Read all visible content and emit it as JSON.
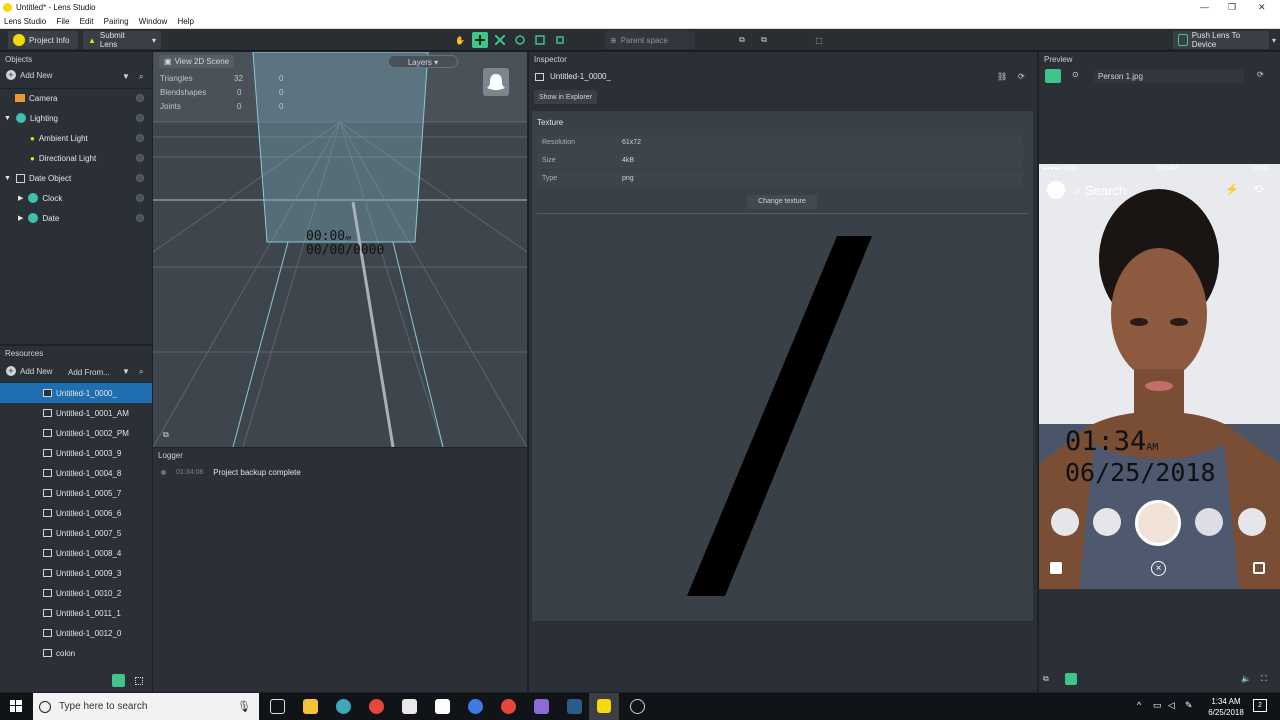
{
  "window": {
    "title": "Untitled* - Lens Studio",
    "minimize": "—",
    "restore": "❐",
    "close": "✕"
  },
  "menu": [
    "Lens Studio",
    "File",
    "Edit",
    "Pairing",
    "Window",
    "Help"
  ],
  "toolbar": {
    "project_info": "Project Info",
    "submit_lens": "Submit Lens",
    "parent_space": "Parent space",
    "push_lens": "Push Lens To Device"
  },
  "objects": {
    "title": "Objects",
    "add_new": "Add New",
    "items": [
      {
        "label": "Camera",
        "icon": "camera-icon"
      },
      {
        "label": "Lighting",
        "icon": "group-icon"
      },
      {
        "label": "Ambient Light",
        "icon": "light-icon"
      },
      {
        "label": "Directional Light",
        "icon": "light-icon"
      },
      {
        "label": "Date Object",
        "icon": "object-icon"
      },
      {
        "label": "Clock",
        "icon": "group-icon"
      },
      {
        "label": "Date",
        "icon": "group-icon"
      }
    ]
  },
  "resources": {
    "title": "Resources",
    "add_new": "Add New",
    "add_from": "Add From...",
    "items": [
      "Untitled-1_0000_",
      "Untitled-1_0001_AM",
      "Untitled-1_0002_PM",
      "Untitled-1_0003_9",
      "Untitled-1_0004_8",
      "Untitled-1_0005_7",
      "Untitled-1_0006_6",
      "Untitled-1_0007_5",
      "Untitled-1_0008_4",
      "Untitled-1_0009_3",
      "Untitled-1_0010_2",
      "Untitled-1_0011_1",
      "Untitled-1_0012_0",
      "colon"
    ]
  },
  "scene": {
    "view_btn": "View 2D Scene",
    "layers": "Layers",
    "stats": [
      {
        "label": "Triangles",
        "a": "32",
        "b": "0"
      },
      {
        "label": "Blendshapes",
        "a": "0",
        "b": "0"
      },
      {
        "label": "Joints",
        "a": "0",
        "b": "0"
      }
    ],
    "time_text": "00:00",
    "time_suffix": "AM",
    "date_text": "00/00/0000"
  },
  "logger": {
    "title": "Logger",
    "entries": [
      {
        "time": "01:34:08",
        "message": "Project backup complete"
      }
    ]
  },
  "inspector": {
    "title": "Inspector",
    "asset_name": "Untitled-1_0000_",
    "show_in_explorer": "Show in Explorer",
    "section": "Texture",
    "rows": [
      {
        "key": "Resolution",
        "value": "61x72"
      },
      {
        "key": "Size",
        "value": "4kB"
      },
      {
        "key": "Type",
        "value": "png"
      }
    ],
    "change_texture": "Change texture"
  },
  "preview": {
    "title": "Preview",
    "file": "Person 1.jpg",
    "status_carrier": "●●●●● Snap",
    "status_time": "9:41 AM",
    "status_batt": "100%",
    "search": "Search",
    "time": "01:34",
    "ampm": "AM",
    "date": "06/25/2018"
  },
  "taskbar": {
    "search_placeholder": "Type here to search",
    "time": "1:34 AM",
    "date": "6/25/2018",
    "notif": "2"
  },
  "colors": {
    "accent": "#1f6fb0",
    "panel": "#2b3036",
    "toolbar_green": "#3fc48a",
    "yellow": "#f5d90a"
  }
}
